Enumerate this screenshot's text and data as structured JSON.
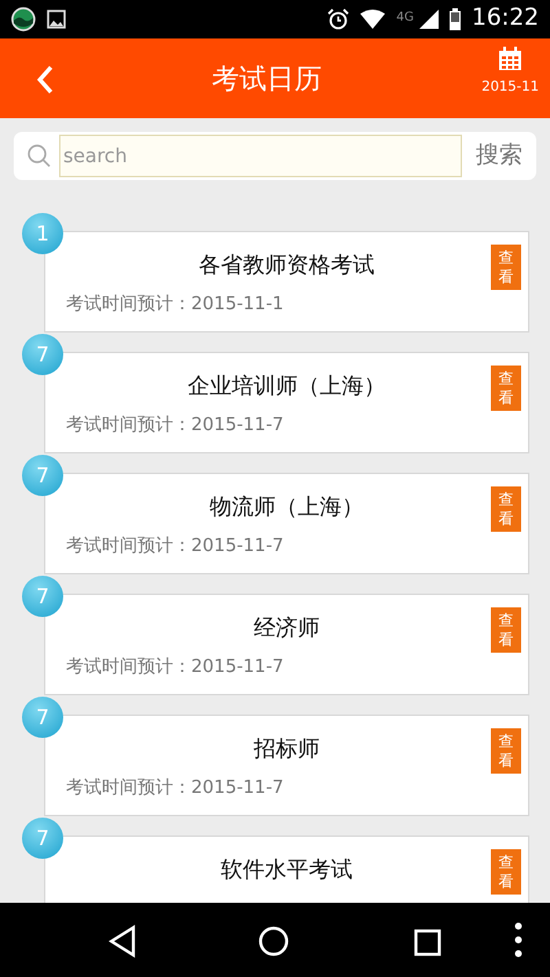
{
  "status_bar": {
    "network": "4G",
    "time": "16:22"
  },
  "header": {
    "title": "考试日历",
    "calendar_label": "2015-11"
  },
  "search": {
    "placeholder": "search",
    "button": "搜索"
  },
  "exams": [
    {
      "day": "1",
      "title": "各省教师资格考试",
      "date": "考试时间预计：2015-11-1",
      "action": "查看"
    },
    {
      "day": "7",
      "title": "企业培训师（上海）",
      "date": "考试时间预计：2015-11-7",
      "action": "查看"
    },
    {
      "day": "7",
      "title": "物流师（上海）",
      "date": "考试时间预计：2015-11-7",
      "action": "查看"
    },
    {
      "day": "7",
      "title": "经济师",
      "date": "考试时间预计：2015-11-7",
      "action": "查看"
    },
    {
      "day": "7",
      "title": "招标师",
      "date": "考试时间预计：2015-11-7",
      "action": "查看"
    },
    {
      "day": "7",
      "title": "软件水平考试",
      "action": "查看"
    }
  ]
}
